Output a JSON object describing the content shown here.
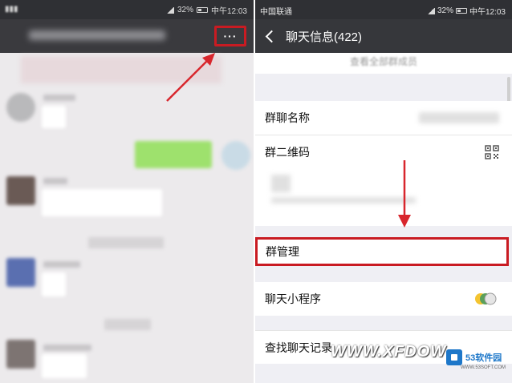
{
  "left": {
    "status": {
      "time": "中午12:03",
      "battery": "32%"
    },
    "more_button_label": "···",
    "chat_label_blur": [
      "Tpechi",
      "@9P 张姗姗",
      "@小鹏 黄姗姗 · 请假"
    ]
  },
  "right": {
    "status": {
      "carrier": "中国联通",
      "battery": "32%",
      "time": "中午12:03"
    },
    "title": "聊天信息(422)",
    "see_all": "查看全部群成员",
    "group_name_label": "群聊名称",
    "qrcode_label": "群二维码",
    "group_manage_label": "群管理",
    "mini_program_label": "聊天小程序",
    "search_history_label": "查找聊天记录"
  },
  "watermark": {
    "text": "WWW.XFDOW",
    "logo_text": "53软件园",
    "logo_sub": "WWW.53SOFT.COM"
  },
  "colors": {
    "highlight": "#c91b22",
    "titlebar": "#36373b",
    "accent_green": "#9ee16d"
  }
}
